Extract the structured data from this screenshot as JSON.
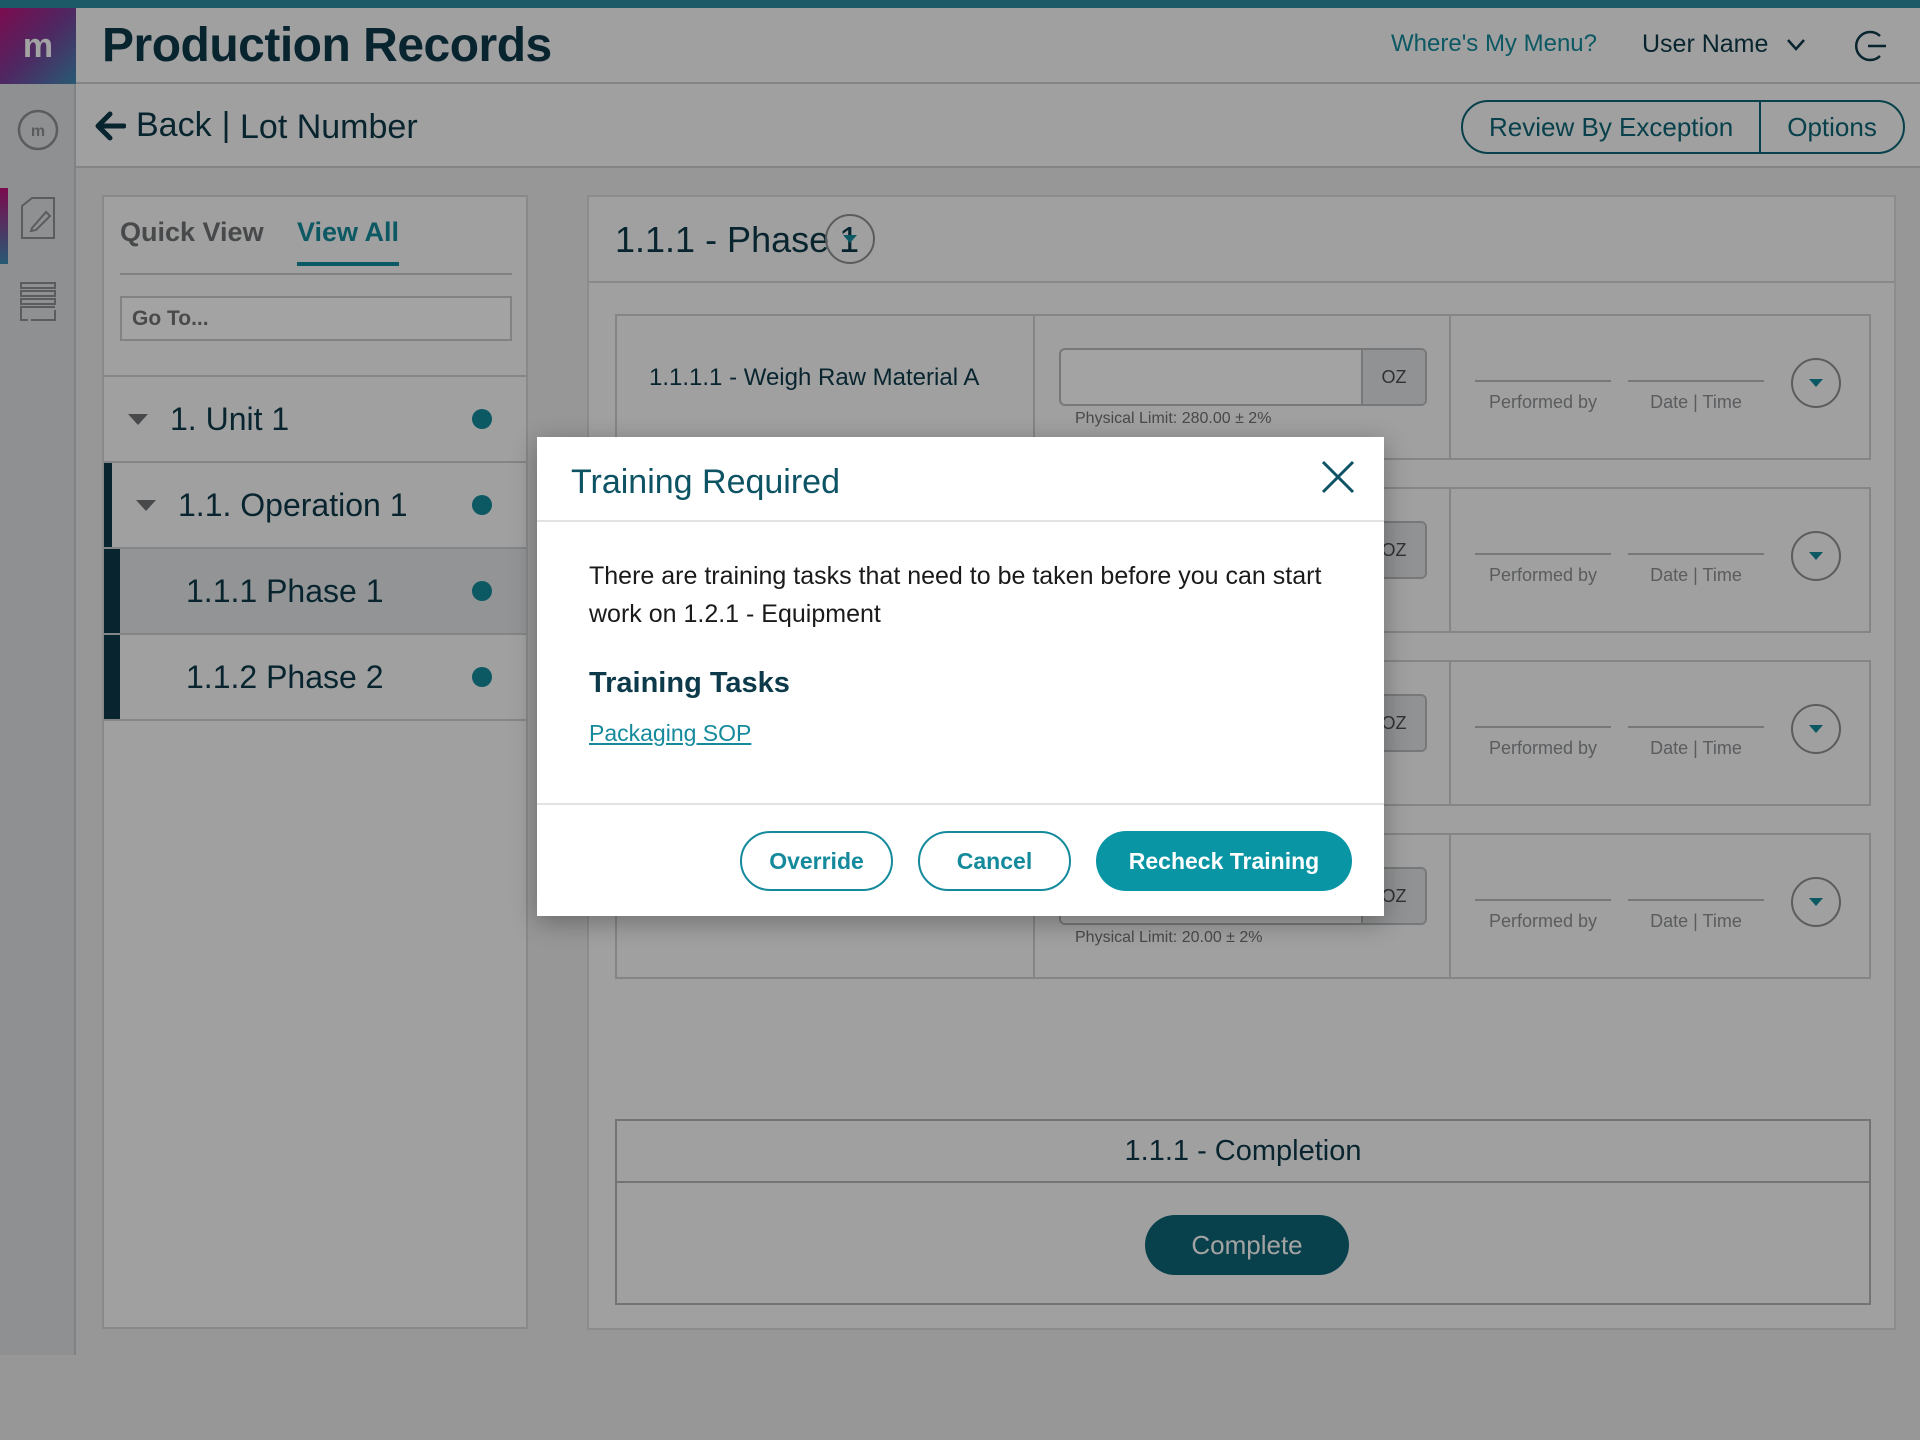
{
  "header": {
    "logo_glyph": "m",
    "app_title": "Production Records",
    "wheres_my_menu": "Where's My Menu?",
    "user_name": "User Name"
  },
  "subheader": {
    "back_label": "Back",
    "separator": "|",
    "lot_number": "Lot Number",
    "review_by_exception": "Review By Exception",
    "options": "Options"
  },
  "sidebar_nav": {
    "tabs": [
      {
        "label": "Quick View",
        "active": false
      },
      {
        "label": "View All",
        "active": true
      }
    ],
    "goto_placeholder": "Go To...",
    "tree": [
      {
        "label": "1. Unit 1",
        "level": 0,
        "expanded": true
      },
      {
        "label": "1.1. Operation 1",
        "level": 1,
        "expanded": true
      },
      {
        "label": "1.1.1 Phase 1",
        "level": 2,
        "selected": true
      },
      {
        "label": "1.1.2 Phase 2",
        "level": 2,
        "selected": false
      }
    ]
  },
  "main": {
    "phase_title": "1.1.1 - Phase 1",
    "steps": [
      {
        "name": "1.1.1.1 - Weigh Raw Material A",
        "unit": "OZ",
        "limit": "Physical Limit: 280.00 ± 2%",
        "performed_by": "Performed by",
        "date_time": "Date | Time"
      },
      {
        "name": "",
        "unit": "OZ",
        "limit": "",
        "performed_by": "Performed by",
        "date_time": "Date | Time"
      },
      {
        "name": "",
        "unit": "OZ",
        "limit": "",
        "performed_by": "Performed by",
        "date_time": "Date | Time"
      },
      {
        "name": "",
        "unit": "OZ",
        "limit": "Physical Limit: 20.00 ± 2%",
        "performed_by": "Performed by",
        "date_time": "Date | Time"
      }
    ],
    "completion_title": "1.1.1 - Completion",
    "complete_button": "Complete"
  },
  "modal": {
    "title": "Training Required",
    "message": "There are training tasks that need to be taken before you can start work on 1.2.1 - Equipment",
    "tasks_heading": "Training Tasks",
    "tasks": [
      "Packaging SOP"
    ],
    "buttons": {
      "override": "Override",
      "cancel": "Cancel",
      "recheck": "Recheck Training"
    }
  },
  "colors": {
    "brand_teal": "#148a9c",
    "primary_button": "#0a95a5",
    "navy_text": "#0d3a4a",
    "complete_button": "#0d6676"
  }
}
